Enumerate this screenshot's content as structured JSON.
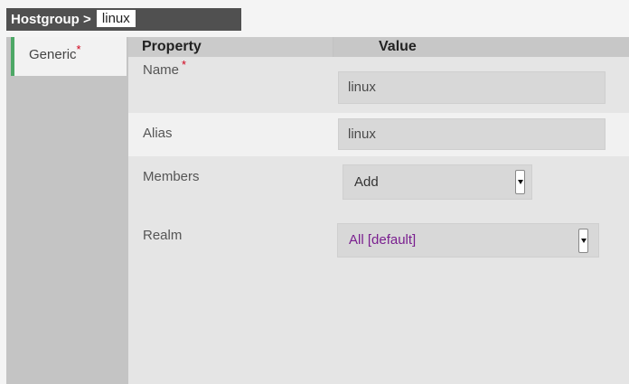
{
  "breadcrumb": {
    "parent": "Hostgroup >",
    "current": "linux"
  },
  "sidebar": {
    "tabs": [
      {
        "label": "Generic",
        "required": "*"
      }
    ]
  },
  "table": {
    "headers": {
      "property": "Property",
      "value": "Value"
    }
  },
  "fields": {
    "name": {
      "label": "Name",
      "required": "*",
      "value": "linux"
    },
    "alias": {
      "label": "Alias",
      "value": "linux"
    },
    "members": {
      "label": "Members",
      "selected": "Add"
    },
    "realm": {
      "label": "Realm",
      "selected": "All [default]"
    }
  },
  "colors": {
    "accent": "#4ea866",
    "required": "#d0021b",
    "realm_value": "#7a1f8f"
  }
}
